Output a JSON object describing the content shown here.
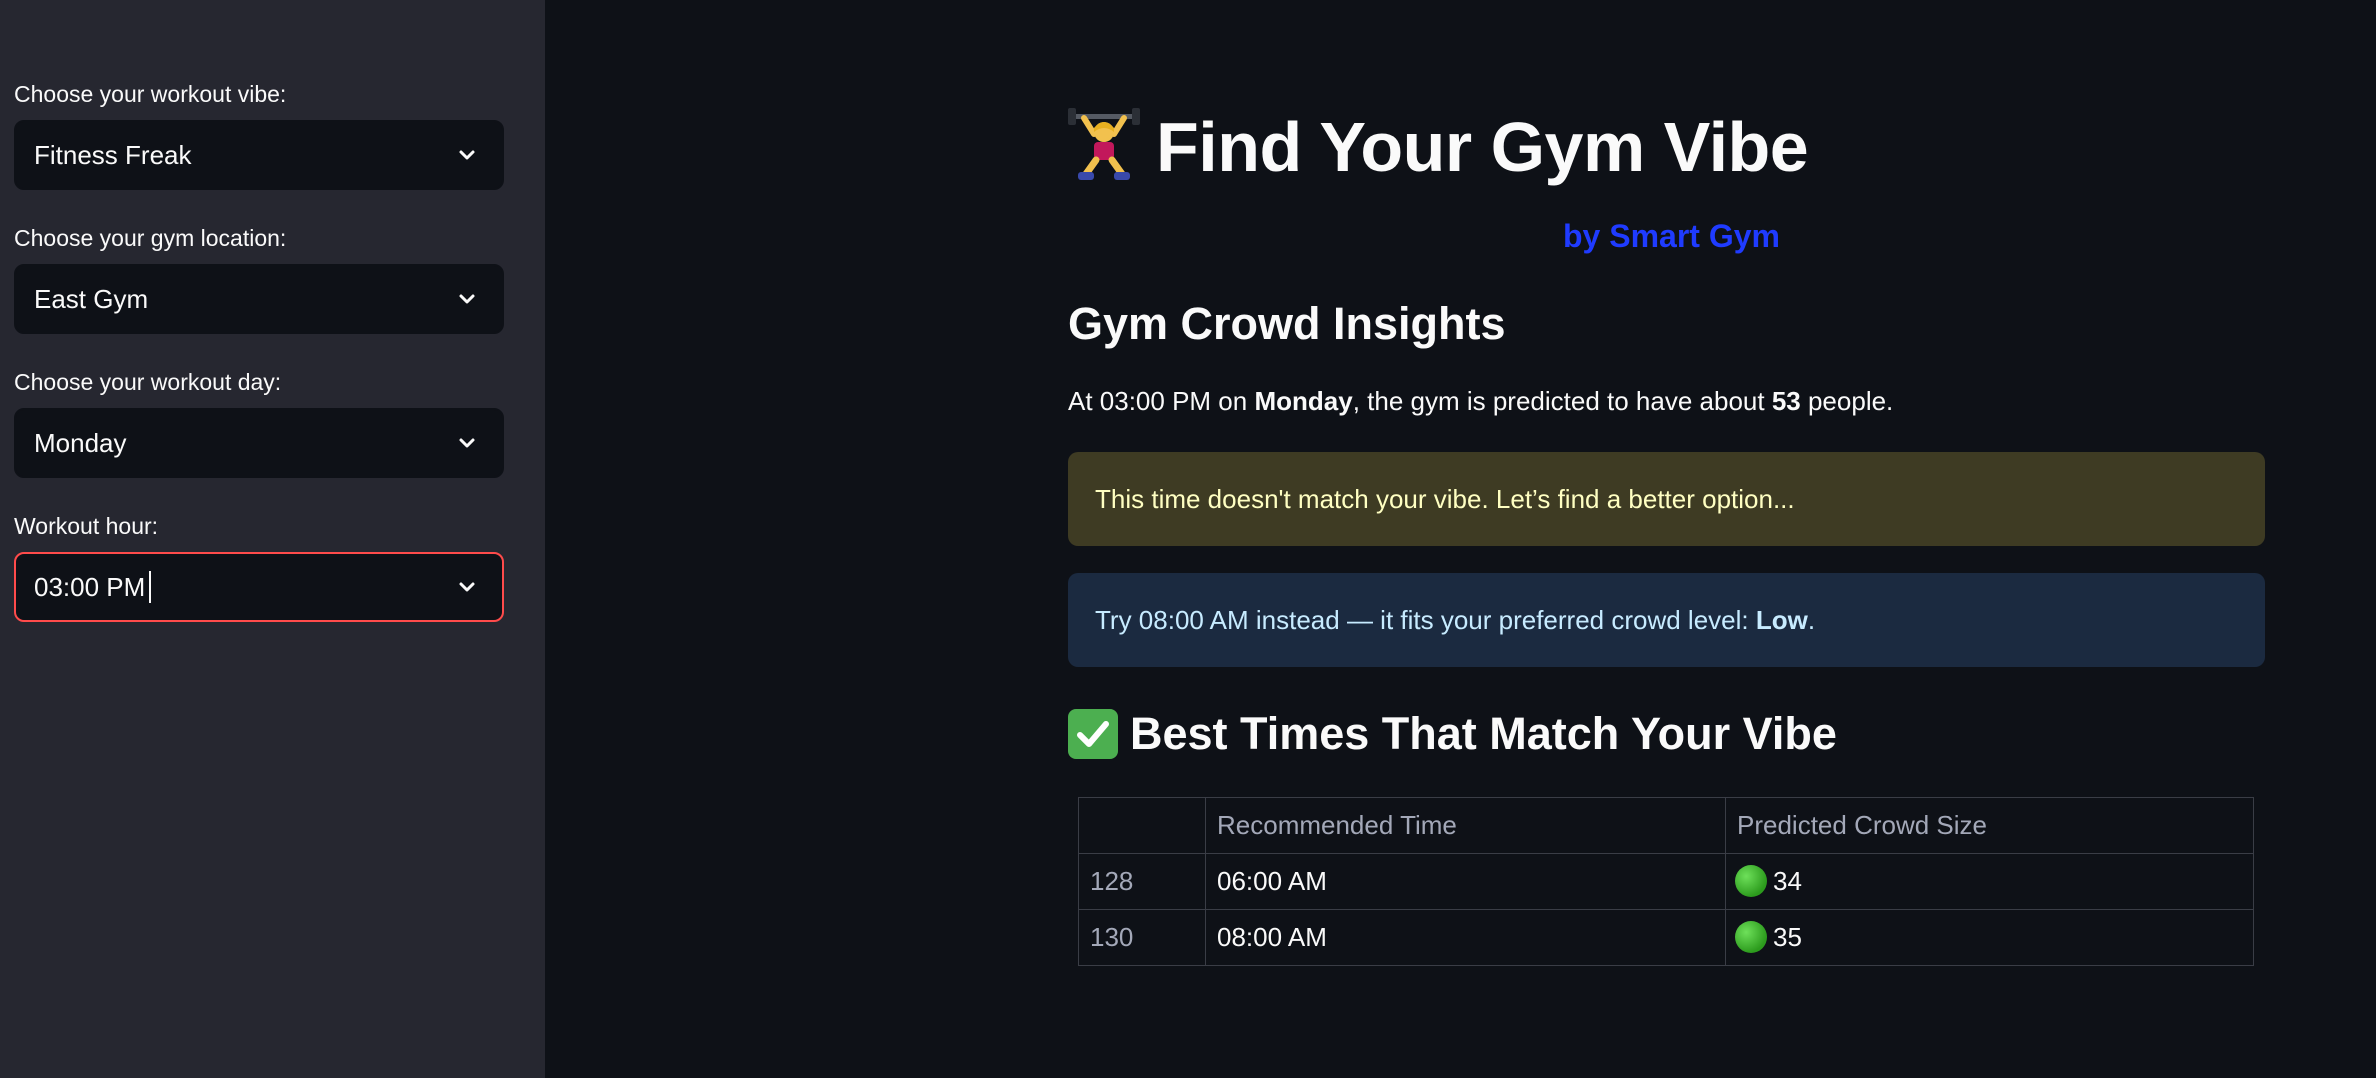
{
  "sidebar": {
    "vibe": {
      "label": "Choose your workout vibe:",
      "value": "Fitness Freak"
    },
    "location": {
      "label": "Choose your gym location:",
      "value": "East Gym"
    },
    "day": {
      "label": "Choose your workout day:",
      "value": "Monday"
    },
    "hour": {
      "label": "Workout hour:",
      "value": "03:00 PM"
    }
  },
  "header": {
    "title_emoji": "weightlifter-emoji",
    "title": "Find Your Gym Vibe",
    "byline": "by Smart Gym"
  },
  "insights": {
    "title": "Gym Crowd Insights",
    "text_prefix": "At 03:00 PM on ",
    "day": "Monday",
    "text_middle": ", the gym is predicted to have about ",
    "count": "53",
    "text_suffix": " people."
  },
  "warning": {
    "text": "This time doesn't match your vibe. Let’s find a better option..."
  },
  "info": {
    "text_prefix": "Try 08:00 AM instead — it fits your preferred crowd level: ",
    "level": "Low",
    "text_suffix": "."
  },
  "best_times": {
    "title": "Best Times That Match Your Vibe",
    "icon": "check-mark-icon",
    "columns": [
      "",
      "Recommended Time",
      "Predicted Crowd Size"
    ],
    "rows": [
      {
        "index": "128",
        "time": "06:00 AM",
        "crowd": "34"
      },
      {
        "index": "130",
        "time": "08:00 AM",
        "crowd": "35"
      }
    ]
  },
  "colors": {
    "sidebar_bg": "#262730",
    "main_bg": "#0e1117",
    "accent_focus": "#ff4b4b",
    "byline": "#1f3bff",
    "warning_bg": "#3e3b23",
    "info_bg": "#1b2a40",
    "status_dot": "#3cba2a"
  }
}
